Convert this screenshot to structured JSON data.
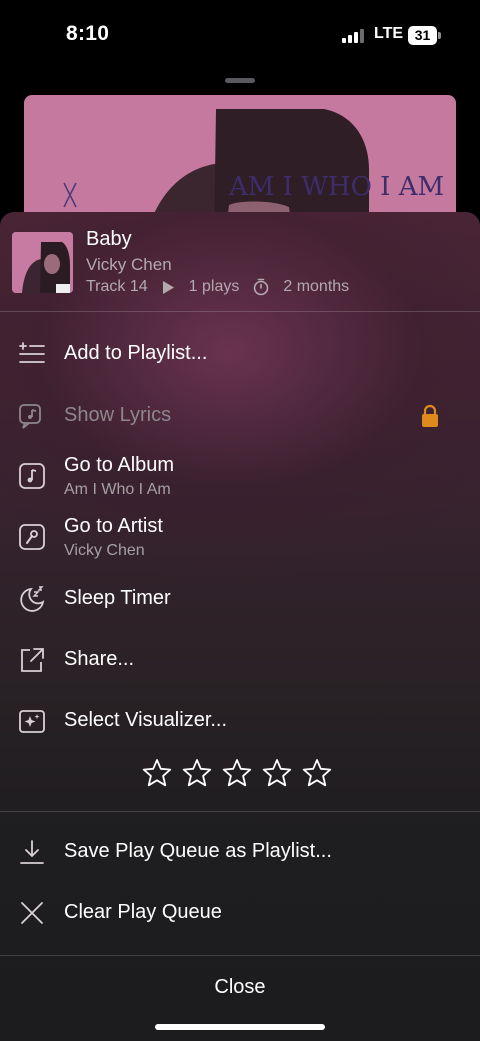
{
  "status_bar": {
    "time": "8:10",
    "network": "LTE",
    "battery": "31"
  },
  "album_art_text": "AM I WHO I AM",
  "now_playing": {
    "title": "Baby",
    "artist": "Vicky Chen",
    "track": "Track 14",
    "plays": "1 plays",
    "added": "2 months"
  },
  "menu": {
    "add_to_playlist": "Add to Playlist...",
    "show_lyrics": "Show Lyrics",
    "go_to_album": "Go to Album",
    "album_name": "Am I Who I Am",
    "go_to_artist": "Go to Artist",
    "artist_name": "Vicky Chen",
    "sleep_timer": "Sleep Timer",
    "share": "Share...",
    "select_visualizer": "Select Visualizer...",
    "save_queue": "Save Play Queue as Playlist...",
    "clear_queue": "Clear Play Queue"
  },
  "rating": {
    "stars_filled": 0,
    "stars_total": 5
  },
  "close_label": "Close",
  "colors": {
    "lock_accent": "#e08a1e",
    "sheet_tint": "#4a2536"
  }
}
